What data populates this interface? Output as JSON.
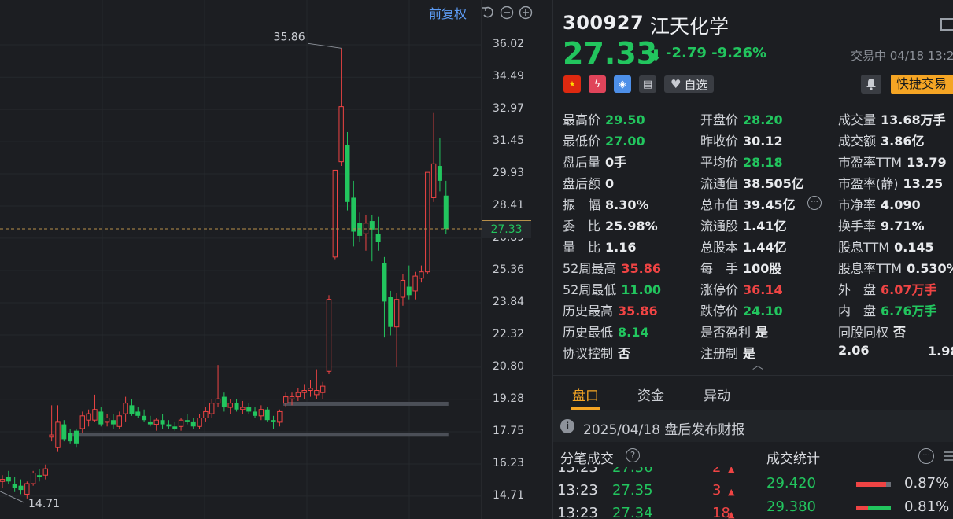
{
  "chart": {
    "adjust_label": "前复权",
    "y_ticks": [
      "36.02",
      "34.49",
      "32.97",
      "31.45",
      "29.93",
      "28.41",
      "26.89",
      "25.36",
      "23.84",
      "22.32",
      "20.80",
      "19.28",
      "17.75",
      "16.23",
      "14.71"
    ],
    "current_price_tag": "27.33",
    "high_marker": "35.86",
    "low_marker": "14.71",
    "colors": {
      "up": "#ef4444",
      "down": "#22c55e",
      "support": "#4b4f57"
    }
  },
  "chart_data": {
    "type": "candlestick",
    "ylim": [
      14.0,
      36.8
    ],
    "candles": [
      {
        "o": 15.4,
        "h": 15.7,
        "l": 15.1,
        "c": 15.5
      },
      {
        "o": 15.6,
        "h": 15.9,
        "l": 15.3,
        "c": 15.4
      },
      {
        "o": 15.3,
        "h": 15.6,
        "l": 14.9,
        "c": 15.1
      },
      {
        "o": 15.2,
        "h": 15.5,
        "l": 14.8,
        "c": 15.0
      },
      {
        "o": 14.8,
        "h": 15.4,
        "l": 14.6,
        "c": 15.3
      },
      {
        "o": 15.3,
        "h": 15.9,
        "l": 15.2,
        "c": 15.8
      },
      {
        "o": 15.7,
        "h": 16.0,
        "l": 15.4,
        "c": 15.6
      },
      {
        "o": 15.7,
        "h": 16.2,
        "l": 15.5,
        "c": 16.0
      },
      {
        "o": 17.5,
        "h": 19.0,
        "l": 17.3,
        "c": 17.6
      },
      {
        "o": 17.0,
        "h": 19.0,
        "l": 16.8,
        "c": 18.2
      },
      {
        "o": 18.1,
        "h": 18.3,
        "l": 17.3,
        "c": 17.4
      },
      {
        "o": 17.7,
        "h": 17.9,
        "l": 17.2,
        "c": 17.3
      },
      {
        "o": 17.8,
        "h": 17.9,
        "l": 17.0,
        "c": 17.2
      },
      {
        "o": 17.9,
        "h": 18.7,
        "l": 17.7,
        "c": 18.5
      },
      {
        "o": 18.3,
        "h": 18.8,
        "l": 18.0,
        "c": 18.6
      },
      {
        "o": 18.3,
        "h": 19.5,
        "l": 18.2,
        "c": 18.8
      },
      {
        "o": 18.7,
        "h": 18.9,
        "l": 18.0,
        "c": 18.1
      },
      {
        "o": 18.2,
        "h": 18.6,
        "l": 18.0,
        "c": 18.4
      },
      {
        "o": 18.3,
        "h": 18.6,
        "l": 17.9,
        "c": 18.1
      },
      {
        "o": 18.0,
        "h": 18.7,
        "l": 17.9,
        "c": 18.5
      },
      {
        "o": 18.6,
        "h": 19.4,
        "l": 18.2,
        "c": 19.1
      },
      {
        "o": 19.0,
        "h": 19.3,
        "l": 18.5,
        "c": 18.6
      },
      {
        "o": 18.7,
        "h": 18.9,
        "l": 18.4,
        "c": 18.5
      },
      {
        "o": 18.5,
        "h": 18.8,
        "l": 18.2,
        "c": 18.3
      },
      {
        "o": 18.2,
        "h": 18.5,
        "l": 18.0,
        "c": 18.1
      },
      {
        "o": 18.1,
        "h": 18.4,
        "l": 17.8,
        "c": 18.3
      },
      {
        "o": 18.3,
        "h": 18.6,
        "l": 17.9,
        "c": 18.1
      },
      {
        "o": 18.1,
        "h": 18.3,
        "l": 17.9,
        "c": 18.0
      },
      {
        "o": 18.0,
        "h": 18.2,
        "l": 17.8,
        "c": 17.9
      },
      {
        "o": 18.0,
        "h": 18.4,
        "l": 17.8,
        "c": 18.3
      },
      {
        "o": 18.3,
        "h": 18.6,
        "l": 18.1,
        "c": 18.2
      },
      {
        "o": 18.2,
        "h": 18.4,
        "l": 17.9,
        "c": 18.0
      },
      {
        "o": 18.0,
        "h": 18.6,
        "l": 17.9,
        "c": 18.4
      },
      {
        "o": 18.4,
        "h": 18.9,
        "l": 18.2,
        "c": 18.7
      },
      {
        "o": 18.6,
        "h": 19.3,
        "l": 18.4,
        "c": 19.1
      },
      {
        "o": 19.1,
        "h": 20.9,
        "l": 18.9,
        "c": 19.3
      },
      {
        "o": 19.4,
        "h": 19.6,
        "l": 18.7,
        "c": 18.9
      },
      {
        "o": 18.9,
        "h": 19.3,
        "l": 18.6,
        "c": 19.1
      },
      {
        "o": 19.1,
        "h": 19.3,
        "l": 18.7,
        "c": 18.8
      },
      {
        "o": 18.8,
        "h": 19.2,
        "l": 18.6,
        "c": 18.9
      },
      {
        "o": 18.9,
        "h": 19.1,
        "l": 18.6,
        "c": 18.7
      },
      {
        "o": 18.7,
        "h": 18.9,
        "l": 18.4,
        "c": 18.5
      },
      {
        "o": 18.5,
        "h": 19.0,
        "l": 18.3,
        "c": 18.8
      },
      {
        "o": 18.8,
        "h": 18.9,
        "l": 18.2,
        "c": 18.3
      },
      {
        "o": 18.3,
        "h": 18.5,
        "l": 17.9,
        "c": 18.2
      },
      {
        "o": 18.2,
        "h": 18.8,
        "l": 18.0,
        "c": 18.7
      },
      {
        "o": 19.1,
        "h": 19.6,
        "l": 18.9,
        "c": 19.4
      },
      {
        "o": 19.3,
        "h": 19.6,
        "l": 19.0,
        "c": 19.4
      },
      {
        "o": 19.4,
        "h": 19.8,
        "l": 19.2,
        "c": 19.6
      },
      {
        "o": 19.6,
        "h": 20.0,
        "l": 19.3,
        "c": 19.7
      },
      {
        "o": 19.7,
        "h": 20.2,
        "l": 19.4,
        "c": 19.8
      },
      {
        "o": 19.5,
        "h": 20.7,
        "l": 19.3,
        "c": 19.7
      },
      {
        "o": 19.6,
        "h": 20.1,
        "l": 19.3,
        "c": 19.9
      },
      {
        "o": 20.6,
        "h": 24.2,
        "l": 20.5,
        "c": 24.0
      },
      {
        "o": 26.0,
        "h": 30.1,
        "l": 25.9,
        "c": 30.1
      },
      {
        "o": 30.5,
        "h": 35.86,
        "l": 30.3,
        "c": 33.1
      },
      {
        "o": 31.3,
        "h": 31.9,
        "l": 28.2,
        "c": 28.6
      },
      {
        "o": 28.8,
        "h": 29.6,
        "l": 26.5,
        "c": 27.2
      },
      {
        "o": 27.6,
        "h": 28.1,
        "l": 26.7,
        "c": 27.0
      },
      {
        "o": 27.1,
        "h": 28.0,
        "l": 26.3,
        "c": 27.6
      },
      {
        "o": 27.7,
        "h": 28.0,
        "l": 25.8,
        "c": 27.3
      },
      {
        "o": 27.1,
        "h": 27.9,
        "l": 26.3,
        "c": 26.7
      },
      {
        "o": 25.7,
        "h": 26.0,
        "l": 22.2,
        "c": 23.9
      },
      {
        "o": 24.1,
        "h": 24.4,
        "l": 22.3,
        "c": 22.7
      },
      {
        "o": 22.7,
        "h": 24.3,
        "l": 20.8,
        "c": 24.0
      },
      {
        "o": 24.1,
        "h": 25.2,
        "l": 23.7,
        "c": 24.9
      },
      {
        "o": 24.6,
        "h": 25.6,
        "l": 24.0,
        "c": 24.2
      },
      {
        "o": 24.4,
        "h": 25.3,
        "l": 24.0,
        "c": 25.1
      },
      {
        "o": 25.0,
        "h": 25.6,
        "l": 24.8,
        "c": 25.3
      },
      {
        "o": 25.3,
        "h": 30.0,
        "l": 25.2,
        "c": 30.0
      },
      {
        "o": 28.8,
        "h": 32.8,
        "l": 28.6,
        "c": 30.4
      },
      {
        "o": 30.3,
        "h": 31.6,
        "l": 29.1,
        "c": 29.6
      },
      {
        "o": 28.9,
        "h": 29.6,
        "l": 27.1,
        "c": 27.33
      }
    ],
    "support_lines": [
      {
        "price": 17.61,
        "from_index": 11,
        "to_index": 72
      },
      {
        "price": 19.07,
        "from_index": 46,
        "to_index": 72
      }
    ],
    "current_price": 27.33
  },
  "stock": {
    "code": "300927",
    "name": "江天化学",
    "price": "27.33",
    "change": "-2.79",
    "change_pct": "-9.26%",
    "status": "交易中 04/18 13:2",
    "fav_label": "自选",
    "quick_trade": "快捷交易"
  },
  "stats": [
    [
      {
        "k": "最高价",
        "v": "29.50",
        "c": "g"
      },
      {
        "k": "开盘价",
        "v": "28.20",
        "c": "g"
      },
      {
        "k": "成交量",
        "v": "13.68万手",
        "c": ""
      }
    ],
    [
      {
        "k": "最低价",
        "v": "27.00",
        "c": "g"
      },
      {
        "k": "昨收价",
        "v": "30.12",
        "c": ""
      },
      {
        "k": "成交额",
        "v": "3.86亿",
        "c": ""
      }
    ],
    [
      {
        "k": "盘后量",
        "v": "0手",
        "c": ""
      },
      {
        "k": "平均价",
        "v": "28.18",
        "c": "g"
      },
      {
        "k": "市盈率TTM",
        "v": "13.79",
        "c": ""
      }
    ],
    [
      {
        "k": "盘后额",
        "v": "0",
        "c": ""
      },
      {
        "k": "流通值",
        "v": "38.505亿",
        "c": ""
      },
      {
        "k": "市盈率(静)",
        "v": "13.25",
        "c": ""
      }
    ],
    [
      {
        "k": "振　幅",
        "v": "8.30%",
        "c": ""
      },
      {
        "k": "总市值",
        "v": "39.45亿",
        "c": ""
      },
      {
        "k": "市净率",
        "v": "4.090",
        "c": ""
      }
    ],
    [
      {
        "k": "委　比",
        "v": "25.98%",
        "c": ""
      },
      {
        "k": "流通股",
        "v": "1.41亿",
        "c": ""
      },
      {
        "k": "换手率",
        "v": "9.71%",
        "c": ""
      }
    ],
    [
      {
        "k": "量　比",
        "v": "1.16",
        "c": ""
      },
      {
        "k": "总股本",
        "v": "1.44亿",
        "c": ""
      },
      {
        "k": "股息TTM",
        "v": "0.145",
        "c": ""
      }
    ],
    [
      {
        "k": "52周最高",
        "v": "35.86",
        "c": "r"
      },
      {
        "k": "每　手",
        "v": "100股",
        "c": ""
      },
      {
        "k": "股息率TTM",
        "v": "0.530%",
        "c": ""
      }
    ],
    [
      {
        "k": "52周最低",
        "v": "11.00",
        "c": "g"
      },
      {
        "k": "涨停价",
        "v": "36.14",
        "c": "r"
      },
      {
        "k": "外　盘",
        "v": "6.07万手",
        "c": "r"
      }
    ],
    [
      {
        "k": "历史最高",
        "v": "35.86",
        "c": "r"
      },
      {
        "k": "跌停价",
        "v": "24.10",
        "c": "g"
      },
      {
        "k": "内　盘",
        "v": "6.76万手",
        "c": "g"
      }
    ],
    [
      {
        "k": "历史最低",
        "v": "8.14",
        "c": "g"
      },
      {
        "k": "是否盈利",
        "v": "是",
        "c": ""
      },
      {
        "k": "同股同权",
        "v": "否",
        "c": ""
      }
    ],
    [
      {
        "k": "协议控制",
        "v": "否",
        "c": ""
      },
      {
        "k": "注册制",
        "v": "是",
        "c": ""
      },
      {
        "k": "",
        "v": "2.06",
        "c": ""
      }
    ]
  ],
  "extra_value": "1.98",
  "tabs": [
    "盘口",
    "资金",
    "异动"
  ],
  "notice": "2025/04/18  盘后发布财报",
  "ticks_title": "分笔成交",
  "stats_title": "成交统计",
  "ticks": [
    {
      "time": "13:23",
      "price": "27.36",
      "vol": "2"
    },
    {
      "time": "13:23",
      "price": "27.35",
      "vol": "3"
    },
    {
      "time": "13:23",
      "price": "27.34",
      "vol": "18"
    }
  ],
  "deal_stats": [
    {
      "price": "29.420",
      "pct": "0.87%",
      "buy": 0.87,
      "sell": 0.13
    },
    {
      "price": "29.380",
      "pct": "0.81%",
      "buy": 0.35,
      "sell": 0.65
    }
  ]
}
